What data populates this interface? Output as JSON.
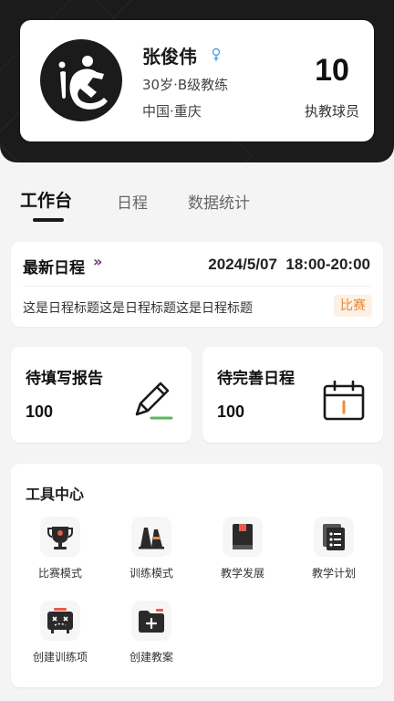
{
  "profile": {
    "name": "张俊伟",
    "age_level": "30岁·B级教练",
    "location": "中国·重庆",
    "stat_value": "10",
    "stat_label": "执教球员"
  },
  "tabs": [
    {
      "label": "工作台",
      "active": true
    },
    {
      "label": "日程",
      "active": false
    },
    {
      "label": "数据统计",
      "active": false
    }
  ],
  "schedule": {
    "title": "最新日程",
    "arrow": "»",
    "date": "2024/5/07",
    "time": "18:00-20:00",
    "description": "这是日程标题这是日程标题这是日程标题",
    "badge": "比赛"
  },
  "pending": [
    {
      "title": "待填写报告",
      "count": "100",
      "icon": "pencil-icon"
    },
    {
      "title": "待完善日程",
      "count": "100",
      "icon": "calendar-icon"
    }
  ],
  "tools": {
    "title": "工具中心",
    "items": [
      {
        "label": "比赛模式",
        "icon": "trophy-icon"
      },
      {
        "label": "训练模式",
        "icon": "cone-icon"
      },
      {
        "label": "教学发展",
        "icon": "book-icon"
      },
      {
        "label": "教学计划",
        "icon": "plan-list-icon"
      },
      {
        "label": "创建训练项",
        "icon": "tactics-board-icon"
      },
      {
        "label": "创建教案",
        "icon": "add-folder-icon"
      }
    ]
  },
  "colors": {
    "dark": "#1b1b1b",
    "badge_bg": "#fdf0e4",
    "badge_text": "#e8883a",
    "accent_red": "#e85a4f",
    "accent_orange": "#f08a3a",
    "accent_green": "#5cb85c"
  }
}
